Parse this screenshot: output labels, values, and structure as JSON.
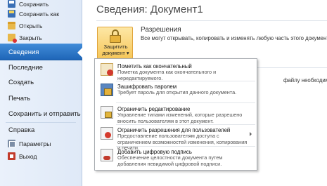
{
  "sidebar": {
    "top_items": [
      {
        "label": "Сохранить",
        "icon": "save-icon"
      },
      {
        "label": "Сохранить как",
        "icon": "save-as-icon"
      },
      {
        "label": "Открыть",
        "icon": "open-folder-icon"
      },
      {
        "label": "Закрыть",
        "icon": "close-document-icon"
      }
    ],
    "active_item": "Сведения",
    "main_items": [
      "Последние",
      "Создать",
      "Печать",
      "Сохранить и отправить",
      "Справка"
    ],
    "bottom_items": [
      {
        "label": "Параметры",
        "icon": "options-icon"
      },
      {
        "label": "Выход",
        "icon": "exit-icon"
      }
    ]
  },
  "main": {
    "title": "Сведения: Документ1",
    "protect_button": {
      "line1": "Защитить",
      "line2": "документ ▾"
    },
    "permissions": {
      "title": "Разрешения",
      "description": "Все могут открывать, копировать и изменять любую часть этого документа."
    },
    "right_fragment": "файлу необходим"
  },
  "menu": {
    "items": [
      {
        "title": "Пометить как окончательный",
        "desc": "Пометка документа как окончательного и нередактируемого.",
        "icon": "mark-final-icon",
        "has_submenu": false
      },
      {
        "title": "Зашифровать паролем",
        "desc": "Требует пароль для открытия данного документа.",
        "icon": "encrypt-password-icon",
        "has_submenu": false
      },
      {
        "title": "Ограничить редактирование",
        "desc": "Управление типами изменений, которые разрешено вносить пользователям в этот документ.",
        "icon": "restrict-editing-icon",
        "has_submenu": false
      },
      {
        "title": "Ограничить разрешения для пользователей",
        "desc": "Предоставление пользователям доступа с ограничением возможностей изменения, копирования и печати.",
        "icon": "restrict-permissions-icon",
        "has_submenu": true
      },
      {
        "title": "Добавить цифровую подпись",
        "desc": "Обеспечение целостности документа путем добавления невидимой цифровой подписи.",
        "icon": "digital-signature-icon",
        "has_submenu": false
      }
    ]
  }
}
